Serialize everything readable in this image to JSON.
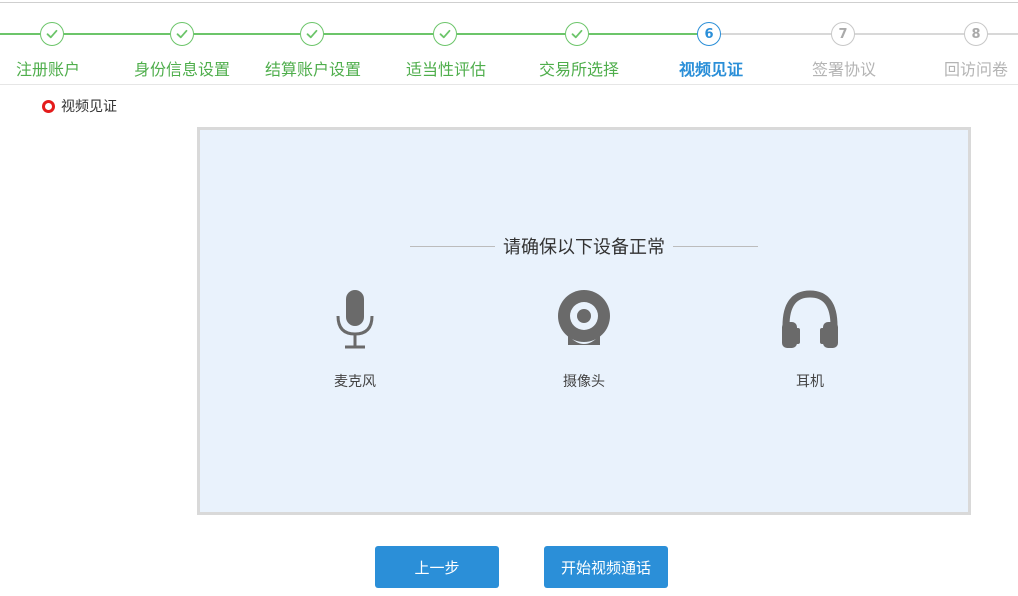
{
  "steps": [
    {
      "label": "注册账户",
      "state": "done",
      "number": ""
    },
    {
      "label": "身份信息设置",
      "state": "done",
      "number": ""
    },
    {
      "label": "结算账户设置",
      "state": "done",
      "number": ""
    },
    {
      "label": "适当性评估",
      "state": "done",
      "number": ""
    },
    {
      "label": "交易所选择",
      "state": "done",
      "number": ""
    },
    {
      "label": "视频见证",
      "state": "active",
      "number": "6"
    },
    {
      "label": "签署协议",
      "state": "todo",
      "number": "7"
    },
    {
      "label": "回访问卷",
      "state": "todo",
      "number": "8"
    }
  ],
  "section": {
    "title": "视频见证",
    "bullet_icon": "red-ring-bullet-icon",
    "bullet_color": "#e41b1b"
  },
  "panel": {
    "heading": "请确保以下设备正常",
    "devices": [
      {
        "label": "麦克风",
        "icon": "microphone-icon"
      },
      {
        "label": "摄像头",
        "icon": "webcam-icon"
      },
      {
        "label": "耳机",
        "icon": "headphones-icon"
      }
    ]
  },
  "buttons": {
    "prev_label": "上一步",
    "start_label": "开始视频通话"
  },
  "colors": {
    "done": "#4fae4c",
    "active": "#2b8fd8",
    "todo": "#b4b4b4",
    "button": "#2b8fd8",
    "panel_bg": "#e9f2fc"
  }
}
